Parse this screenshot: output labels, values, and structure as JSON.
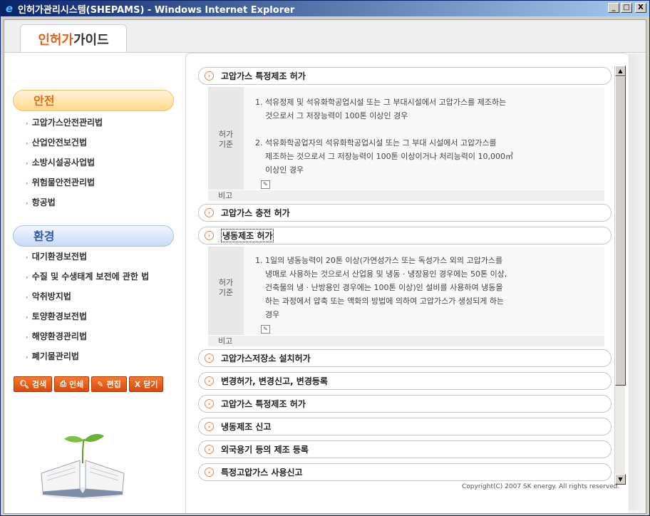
{
  "window": {
    "title": "인허가관리시스템(SHEPAMS) - Windows Internet Explorer",
    "minimize": "_",
    "maximize": "□",
    "close": "X"
  },
  "header": {
    "tab_part1": "인허가",
    "tab_part2": "가이드"
  },
  "sidebar": {
    "safety_label": "안전",
    "safety_items": [
      "고압가스안전관리법",
      "산업안전보건법",
      "소방시설공사업법",
      "위험물안전관리법",
      "항공법"
    ],
    "env_label": "환경",
    "env_items": [
      "대기환경보전법",
      "수질 및 수생태계 보전에 관한 법",
      "악취방지법",
      "토양환경보전법",
      "해양환경관리법",
      "폐기물관리법"
    ],
    "buttons": [
      {
        "icon": "search-icon",
        "label": "검색"
      },
      {
        "icon": "print-icon",
        "label": "인쇄"
      },
      {
        "icon": "edit-icon",
        "label": "편집"
      },
      {
        "icon": "close-icon",
        "label": "닫기"
      }
    ]
  },
  "main": {
    "sections": [
      {
        "title": "고압가스 특정제조 허가",
        "expanded": true
      },
      {
        "title": "고압가스 충전 허가",
        "expanded": false
      },
      {
        "title": "냉동제조 허가",
        "expanded": true
      },
      {
        "title": "고압가스저장소 설치허가",
        "expanded": false
      },
      {
        "title": "변경허가, 변경신고, 변경등록",
        "expanded": false
      },
      {
        "title": "고압가스 특정제조 허가",
        "expanded": false
      },
      {
        "title": "냉동제조 신고",
        "expanded": false
      },
      {
        "title": "외국용기 등의 제조 등록",
        "expanded": false
      },
      {
        "title": "특정고압가스 사용신고",
        "expanded": false
      }
    ],
    "detail1": {
      "head": "허가\n기준",
      "lines": [
        "1. 석유정제 및 석유화학공업시설 또는 그 부대시설에서 고압가스를 제조하는",
        "    것으로서 그 저장능력이 100톤 이상인 경우",
        "2. 석유화학공업자의 석유화학공업시설 또는 그 부대 시설에서 고압가스를",
        "    제조하는 것으로서 그 저장능력이 100톤 이상이거나 처리능력이 10,000㎥",
        "    이상인 경우"
      ],
      "note": "비고"
    },
    "detail2": {
      "head": "허가\n기준",
      "lines": [
        "1. 1일의 냉동능력이 20톤 이상(가연성가스 또는 독성가스 외의 고압가스를",
        "    냉매로 사용하는 것으로서 산업용 및 냉동 · 냉장용인 경우에는 50톤 이상,",
        "    건축물의 냉 · 난방용인 경우에는 100톤 이상)인 설비를 사용하여 냉동을",
        "    하는 과정에서 압축 또는 액화의 방법에 의하여 고압가스가 생성되게 하는",
        "    경우"
      ],
      "note": "비고"
    },
    "copyright": "Copyright(C) 2007 SK energy. All rights reserved."
  },
  "colors": {
    "title_bar": "#0a246a",
    "accent_orange": "#e0621e",
    "env_blue": "#2c5aa8",
    "button_orange": "#e85d1c"
  }
}
